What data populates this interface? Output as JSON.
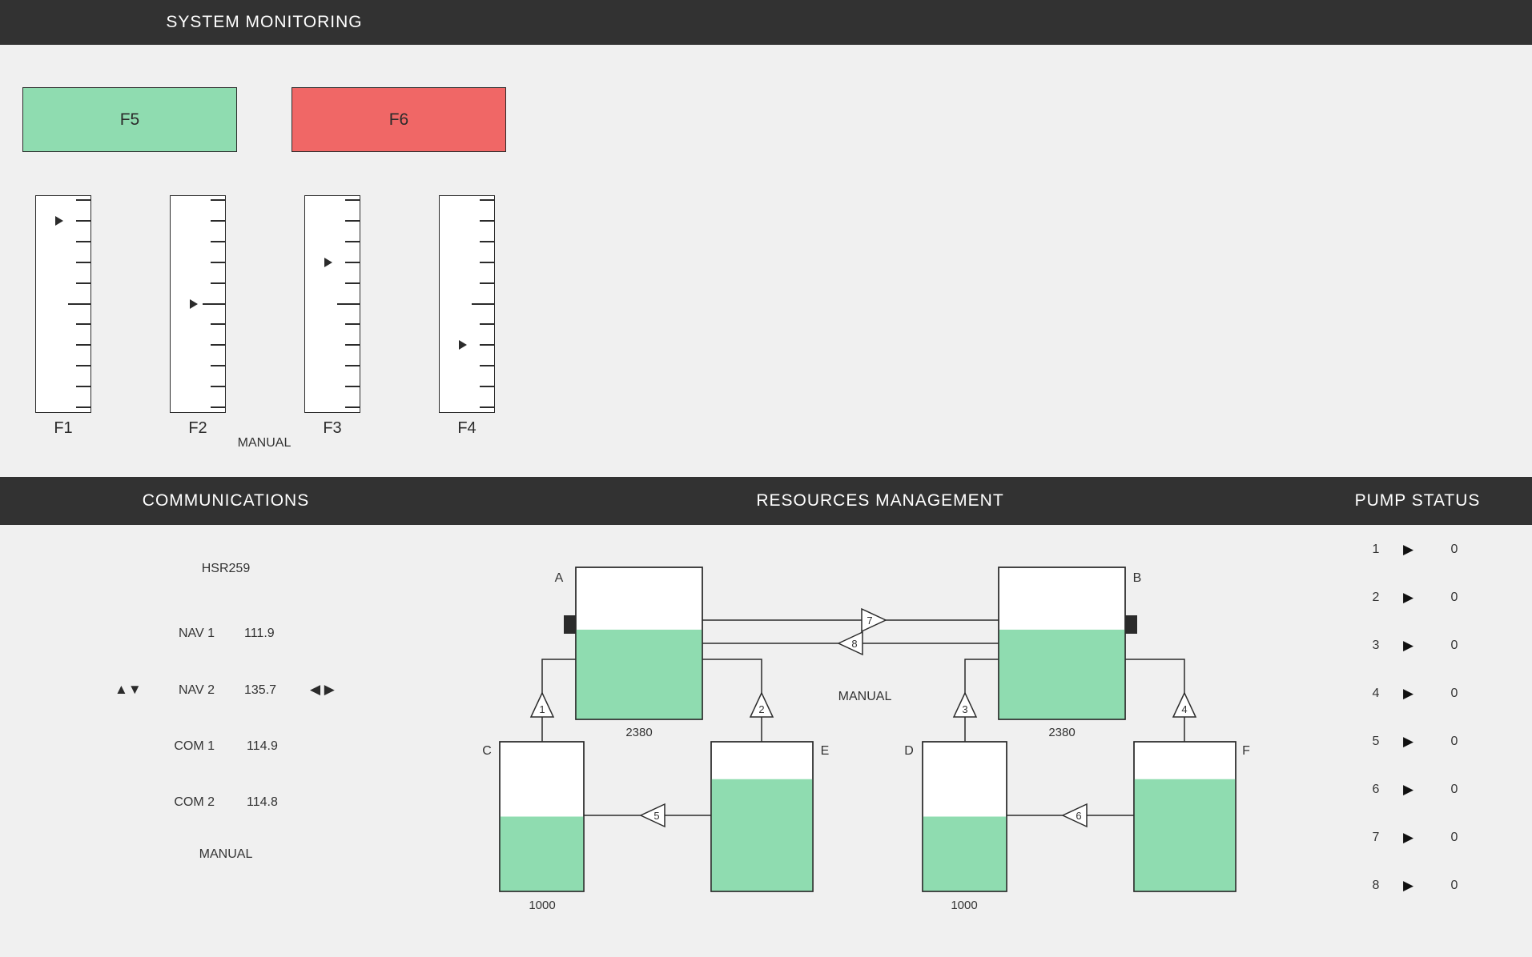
{
  "header": {
    "title": "SYSTEM MONITORING"
  },
  "function_keys": [
    {
      "label": "F5",
      "color": "#8fdcb0"
    },
    {
      "label": "F6",
      "color": "#f06766"
    }
  ],
  "scales": [
    {
      "label": "F1",
      "pointer_level": 0.9
    },
    {
      "label": "F2",
      "pointer_level": 0.5
    },
    {
      "label": "F3",
      "pointer_level": 0.7
    },
    {
      "label": "F4",
      "pointer_level": 0.3
    }
  ],
  "monitoring_mode": "MANUAL",
  "sections": {
    "communications": "COMMUNICATIONS",
    "resources": "RESOURCES MANAGEMENT",
    "pumps": "PUMP STATUS"
  },
  "communications": {
    "callsign": "HSR259",
    "radios": [
      {
        "name": "NAV 1",
        "value": "111.9",
        "selected": false
      },
      {
        "name": "NAV 2",
        "value": "135.7",
        "selected": true
      },
      {
        "name": "COM 1",
        "value": "114.9",
        "selected": false
      },
      {
        "name": "COM 2",
        "value": "114.8",
        "selected": false
      }
    ],
    "mode": "MANUAL",
    "controls": {
      "up_down_icon": "up-down-arrows",
      "left_right_icon": "left-right-arrows"
    }
  },
  "resources": {
    "mode": "MANUAL",
    "tanks": [
      {
        "id": "A",
        "level": 0.59,
        "capacity": "2380"
      },
      {
        "id": "B",
        "level": 0.59,
        "capacity": "2380"
      },
      {
        "id": "C",
        "level": 0.5,
        "capacity": "1000"
      },
      {
        "id": "D",
        "level": 0.5,
        "capacity": "1000"
      },
      {
        "id": "E",
        "level": 0.75
      },
      {
        "id": "F",
        "level": 0.75
      }
    ],
    "pumps": [
      "1",
      "2",
      "3",
      "4",
      "5",
      "6",
      "7",
      "8"
    ],
    "fill_color": "#8fdcb0"
  },
  "pump_status": [
    {
      "num": "1",
      "icon": "play-arrow",
      "value": "0"
    },
    {
      "num": "2",
      "icon": "play-arrow",
      "value": "0"
    },
    {
      "num": "3",
      "icon": "play-arrow",
      "value": "0"
    },
    {
      "num": "4",
      "icon": "play-arrow",
      "value": "0"
    },
    {
      "num": "5",
      "icon": "play-arrow",
      "value": "0"
    },
    {
      "num": "6",
      "icon": "play-arrow",
      "value": "0"
    },
    {
      "num": "7",
      "icon": "play-arrow",
      "value": "0"
    },
    {
      "num": "8",
      "icon": "play-arrow",
      "value": "0"
    }
  ]
}
